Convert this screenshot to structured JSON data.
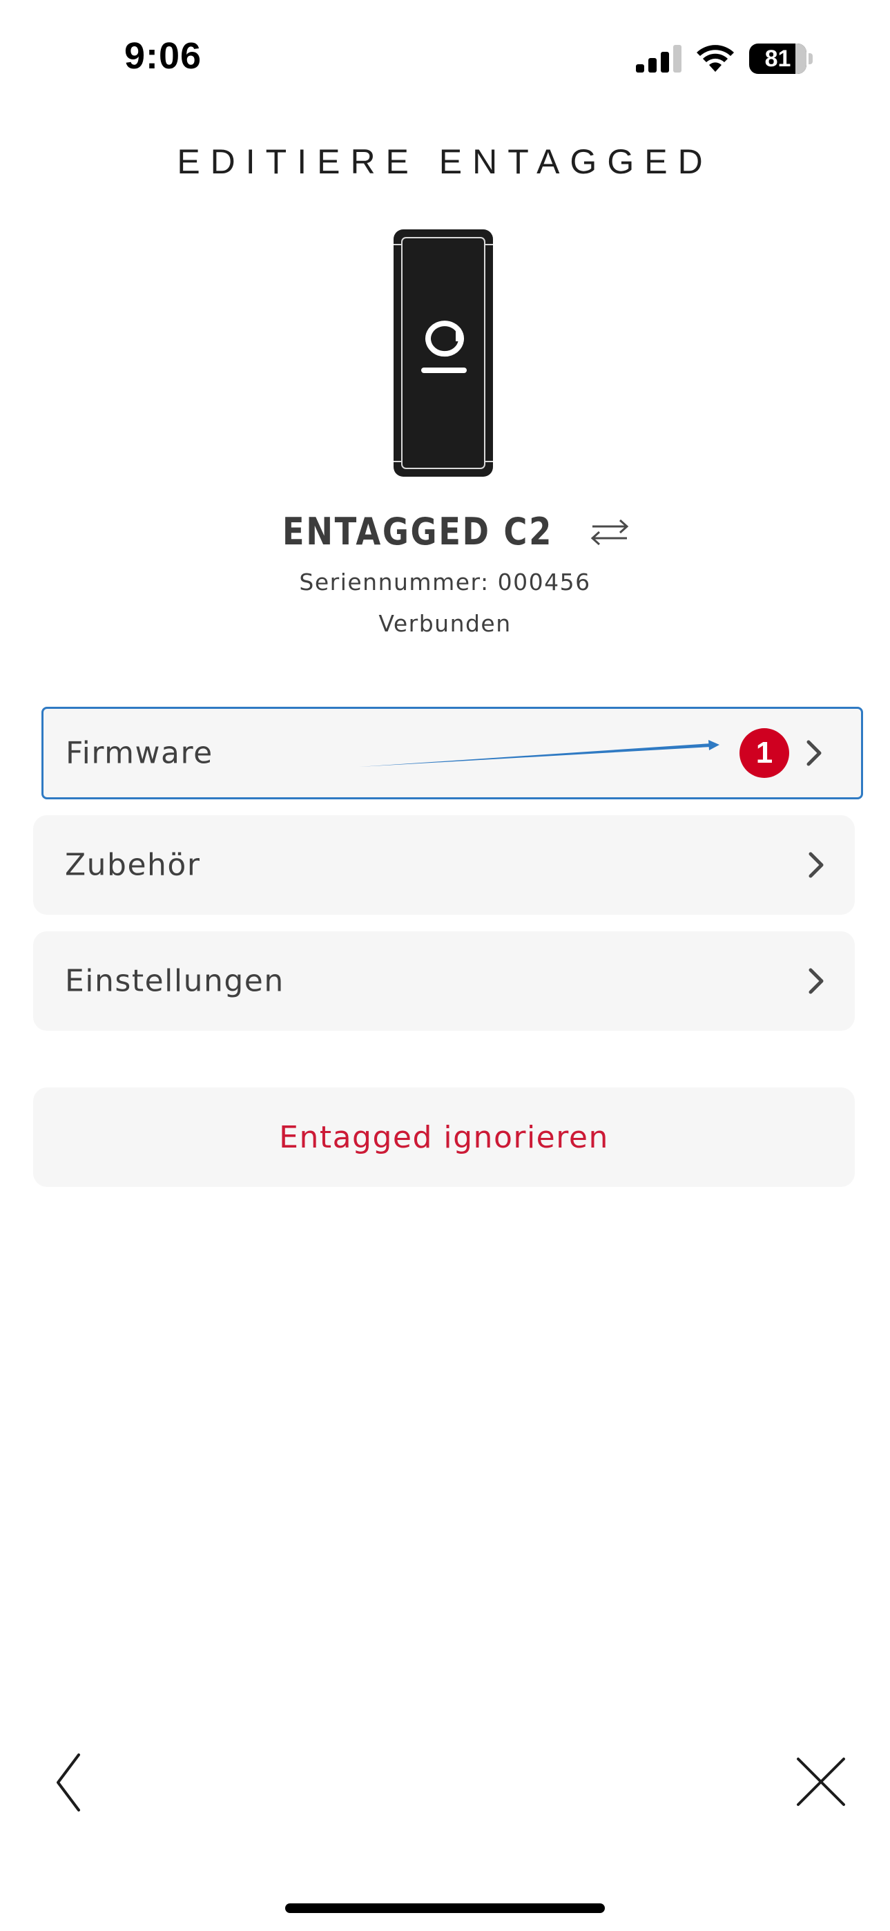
{
  "status_bar": {
    "time": "9:06",
    "battery": "81",
    "battery_level": 81
  },
  "header": {
    "title": "EDITIERE ENTAGGED"
  },
  "device": {
    "image_icon": "entagged-device-icon",
    "name": "ENTAGGED C2",
    "swap_icon": "swap-arrows-icon",
    "serial": "Seriennummer: 000456",
    "status": "Verbunden"
  },
  "menu": {
    "items": [
      {
        "label": "Firmware",
        "badge": "1",
        "selected": true
      },
      {
        "label": "Zubehör"
      },
      {
        "label": "Einstellungen"
      }
    ]
  },
  "actions": {
    "ignore_label": "Entagged ignorieren"
  },
  "bottom_nav": {
    "back_icon": "chevron-left-icon",
    "close_icon": "close-icon"
  },
  "colors": {
    "accent_red": "#cc1a36",
    "badge_red": "#cf0020",
    "selection_blue": "#2f7ac3",
    "row_background": "#f6f6f6",
    "text": "#404040"
  }
}
